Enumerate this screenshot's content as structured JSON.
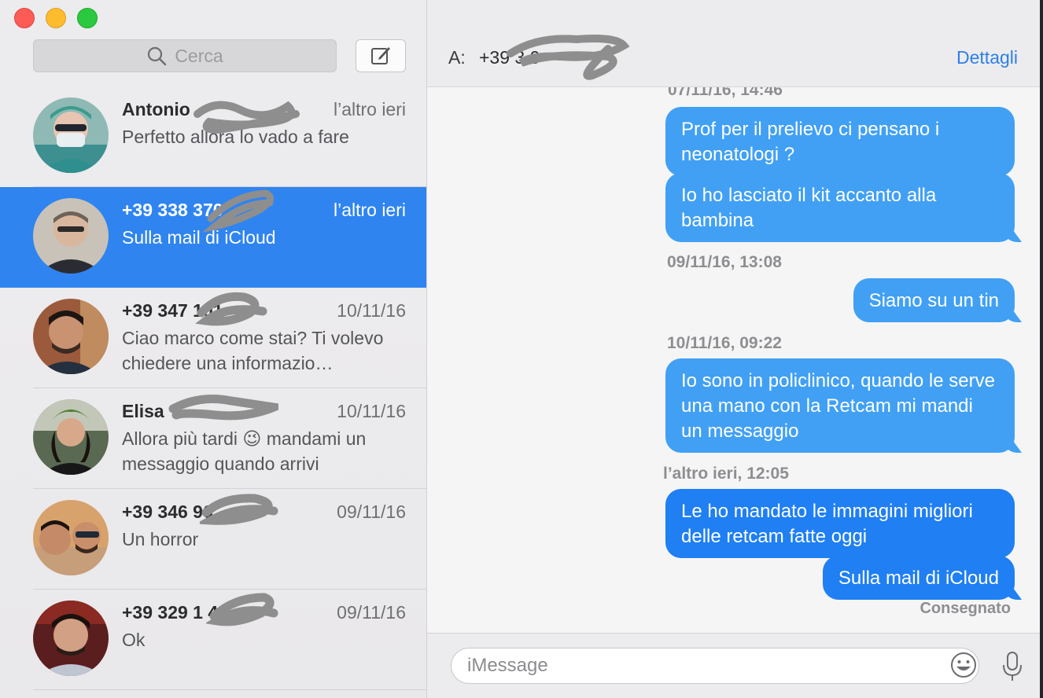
{
  "window": {
    "traffic_lights": {
      "close": "#fd5c56",
      "minimize": "#fdbb2e",
      "zoom": "#2ac940"
    },
    "accent": "#2f84f0"
  },
  "sidebar": {
    "search_placeholder": "Cerca",
    "search_icon": "search-icon",
    "compose_icon": "compose-icon",
    "conversations": [
      {
        "name": "Antonio",
        "date": "l’altro ieri",
        "preview": "Perfetto allora lo vado a fare",
        "selected": false
      },
      {
        "name": "+39 338 370",
        "date": "l’altro ieri",
        "preview": "Sulla mail di iCloud",
        "selected": true
      },
      {
        "name": "+39 347 101",
        "date": "10/11/16",
        "preview": "Ciao marco come stai? Ti volevo chiedere una informazio…",
        "selected": false
      },
      {
        "name": "Elisa",
        "date": "10/11/16",
        "preview": "Allora più tardi 😉 mandami un messaggio quando arrivi",
        "selected": false
      },
      {
        "name": "+39 346 96",
        "date": "09/11/16",
        "preview": "Un horror",
        "selected": false
      },
      {
        "name": "+39 329 1 4",
        "date": "09/11/16",
        "preview": "Ok",
        "selected": false
      }
    ]
  },
  "header": {
    "to_label": "A:",
    "to_value": "+39 3 0",
    "details_label": "Dettagli"
  },
  "transcript": {
    "items": [
      {
        "kind": "timestamp",
        "text": "07/11/16, 14:46"
      },
      {
        "kind": "bubble",
        "text": "Prof per il prelievo ci pensano i neonatologi ?"
      },
      {
        "kind": "bubble",
        "text": "Io ho lasciato il kit accanto alla bambina"
      },
      {
        "kind": "timestamp",
        "text": "09/11/16, 13:08"
      },
      {
        "kind": "bubble",
        "text": "Siamo su un tin"
      },
      {
        "kind": "timestamp",
        "text": "10/11/16, 09:22"
      },
      {
        "kind": "bubble",
        "text": "Io sono in policlinico, quando le serve una mano con la Retcam mi mandi un messaggio"
      },
      {
        "kind": "timestamp",
        "text": "l’altro ieri, 12:05"
      },
      {
        "kind": "bubble",
        "text": "Le ho mandato le immagini migliori delle retcam fatte oggi"
      },
      {
        "kind": "bubble",
        "text": "Sulla mail di iCloud"
      }
    ],
    "delivered": "Consegnato",
    "bubble_color": "#41a0f4",
    "bubble_color_recent": "#1f7ff3"
  },
  "composer": {
    "placeholder": "iMessage",
    "emoji_icon": "emoji-icon",
    "mic_icon": "microphone-icon"
  }
}
